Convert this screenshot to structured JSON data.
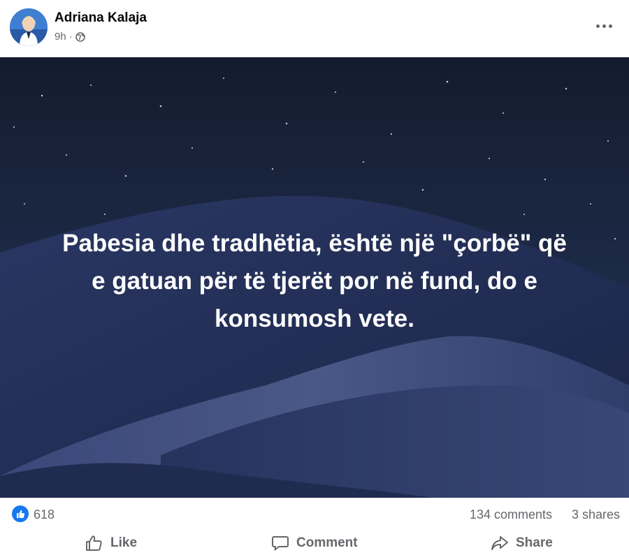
{
  "post": {
    "author": "Adriana Kalaja",
    "time": "9h",
    "separator": "·",
    "privacy_icon": "globe-icon"
  },
  "image": {
    "quote_lines": [
      "Pabesia dhe tradhëtia, është një \"çorbë\" që",
      "e gatuan për të tjerët por në fund, do e",
      "konsumosh vete."
    ]
  },
  "reactions": {
    "like_count": "618",
    "comments": "134 comments",
    "shares": "3 shares"
  },
  "actions": {
    "like": "Like",
    "comment": "Comment",
    "share": "Share"
  },
  "colors": {
    "accent": "#1877f2",
    "secondary_text": "#65676b",
    "night_sky": "#1b2a45",
    "dune": "#2f3c66"
  }
}
